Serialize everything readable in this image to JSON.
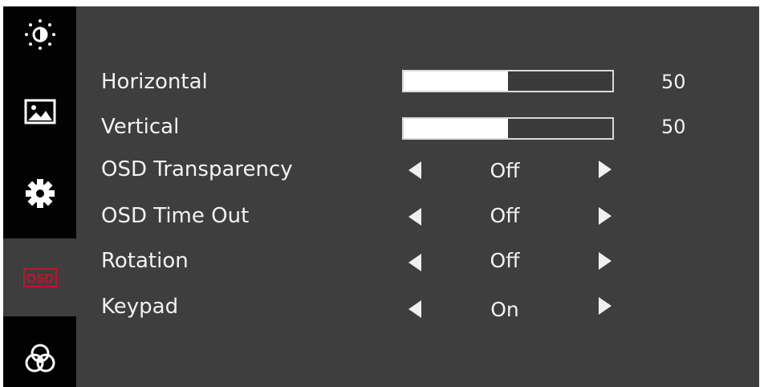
{
  "sidebar": {
    "tabs": [
      {
        "icon": "brightness-icon",
        "active": false
      },
      {
        "icon": "picture-icon",
        "active": false
      },
      {
        "icon": "settings-gear-icon",
        "active": false
      },
      {
        "icon": "osd-icon",
        "label": "OSD",
        "active": true
      },
      {
        "icon": "color-icon",
        "active": false
      }
    ]
  },
  "menu": {
    "horizontal": {
      "label": "Horizontal",
      "value": "50",
      "level": 0.5
    },
    "vertical": {
      "label": "Vertical",
      "value": "50",
      "level": 0.5
    },
    "osd_transparency": {
      "label": "OSD Transparency",
      "value": "Off"
    },
    "osd_time_out": {
      "label": "OSD Time Out",
      "value": "Off"
    },
    "rotation": {
      "label": "Rotation",
      "value": "Off"
    },
    "keypad": {
      "label": "Keypad",
      "value": "On"
    }
  },
  "colors": {
    "background": "#3e3e3e",
    "sidebar": "#020202",
    "osd_accent": "#c8102e",
    "text": "#f2f2f2"
  }
}
